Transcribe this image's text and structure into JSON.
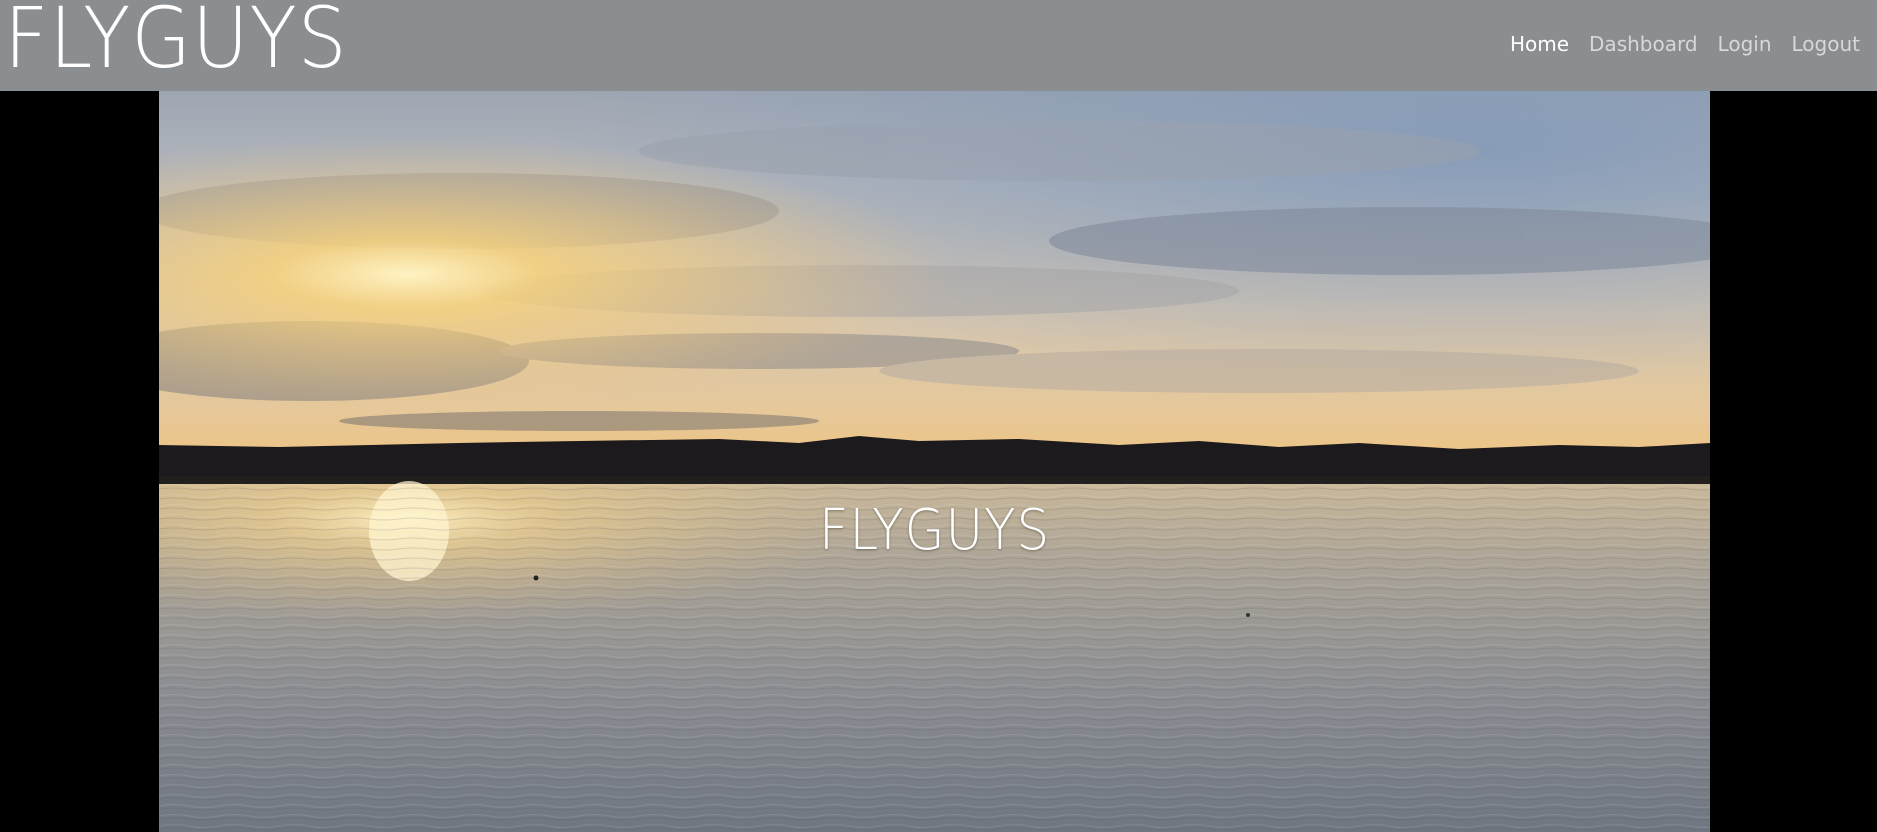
{
  "navbar": {
    "brand": "FLYGUYS",
    "links": [
      {
        "label": "Home",
        "active": true
      },
      {
        "label": "Dashboard",
        "active": false
      },
      {
        "label": "Login",
        "active": false
      },
      {
        "label": "Logout",
        "active": false
      }
    ]
  },
  "hero": {
    "title": "FLYGUYS",
    "media": "sunset-over-lake-video"
  },
  "colors": {
    "navbar_bg": "#8a8e91",
    "nav_active": "#ffffff",
    "nav_inactive": "#d6d8da",
    "page_bg": "#000000"
  }
}
